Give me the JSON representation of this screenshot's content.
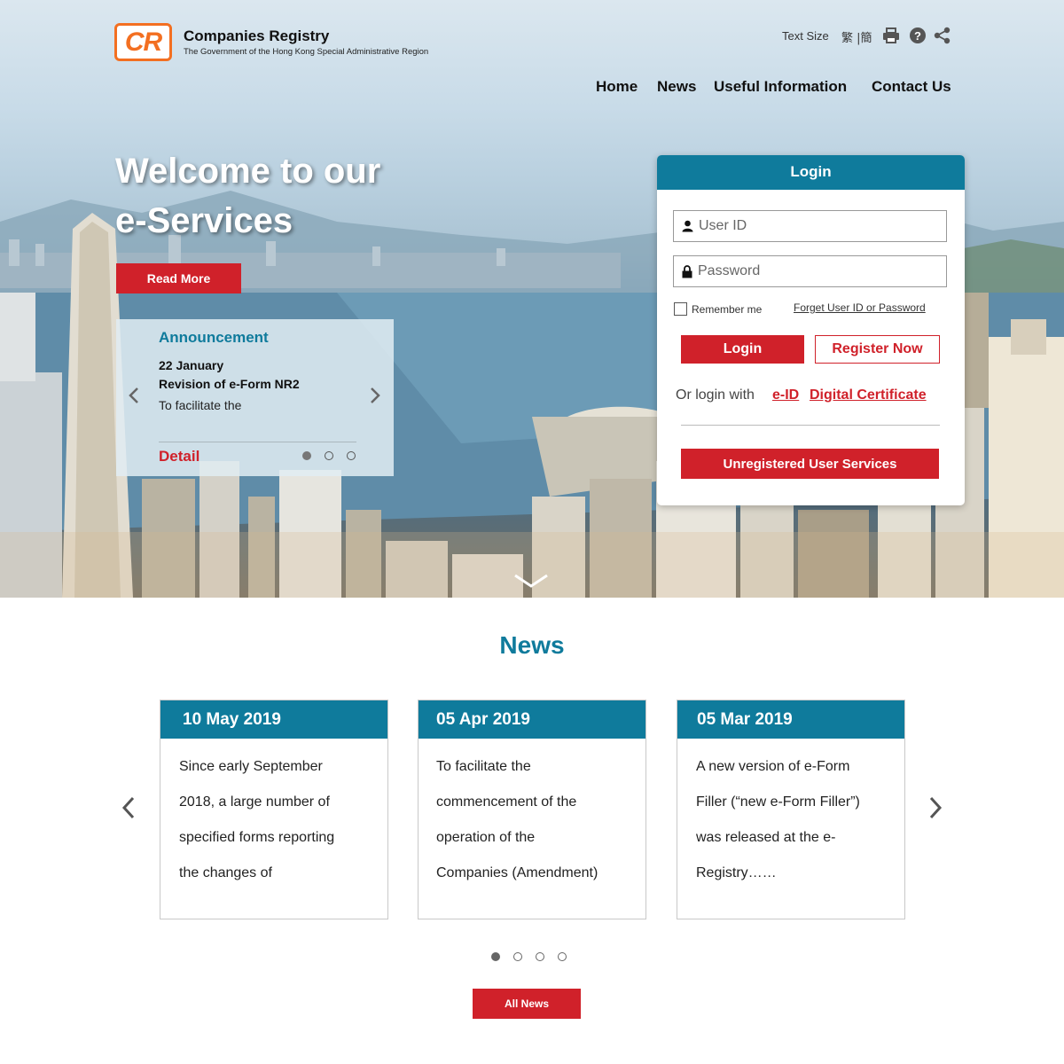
{
  "header": {
    "logo_text": "CR",
    "title": "Companies Registry",
    "subtitle": "The Government of the Hong Kong Special Administrative Region",
    "text_size_label": "Text Size",
    "lang_label": "繁 |簡",
    "icons": [
      "print-icon",
      "help-icon",
      "share-icon"
    ]
  },
  "nav": {
    "items": [
      "Home",
      "News",
      "Useful Information",
      "Contact Us"
    ]
  },
  "hero": {
    "welcome_line1": "Welcome to our",
    "welcome_line2": "e-Services",
    "read_more": "Read More"
  },
  "announcement": {
    "title": "Announcement",
    "date": "22 January",
    "headline": "Revision of e-Form NR2",
    "body": "To facilitate the",
    "detail": "Detail",
    "active_dot": 1,
    "dot_count": 3
  },
  "login": {
    "title": "Login",
    "user_placeholder": "User ID",
    "password_placeholder": "Password",
    "remember": "Remember me",
    "forget": "Forget User ID or Password",
    "login_button": "Login",
    "register_button": "Register Now",
    "or_login_with": "Or login with",
    "eid": "e-ID",
    "digital_certificate": "Digital Certificate",
    "unregistered": "Unregistered User Services"
  },
  "news": {
    "title": "News",
    "cards": [
      {
        "date": "10 May 2019",
        "lines": [
          "Since early September",
          "2018, a large number of",
          "specified forms reporting",
          "the changes of"
        ]
      },
      {
        "date": "05 Apr 2019",
        "lines": [
          "To facilitate the",
          "commencement of the",
          "operation of the",
          "Companies (Amendment)"
        ]
      },
      {
        "date": "05 Mar 2019",
        "lines": [
          "A new version of e-Form",
          "Filler (“new e-Form Filler”)",
          "was released at the e-",
          "Registry……"
        ]
      }
    ],
    "active_dot": 1,
    "dot_count": 4,
    "all_news": "All News"
  },
  "colors": {
    "brand_orange": "#f36f21",
    "accent_teal": "#0f7b9c",
    "action_red": "#d0212a"
  }
}
